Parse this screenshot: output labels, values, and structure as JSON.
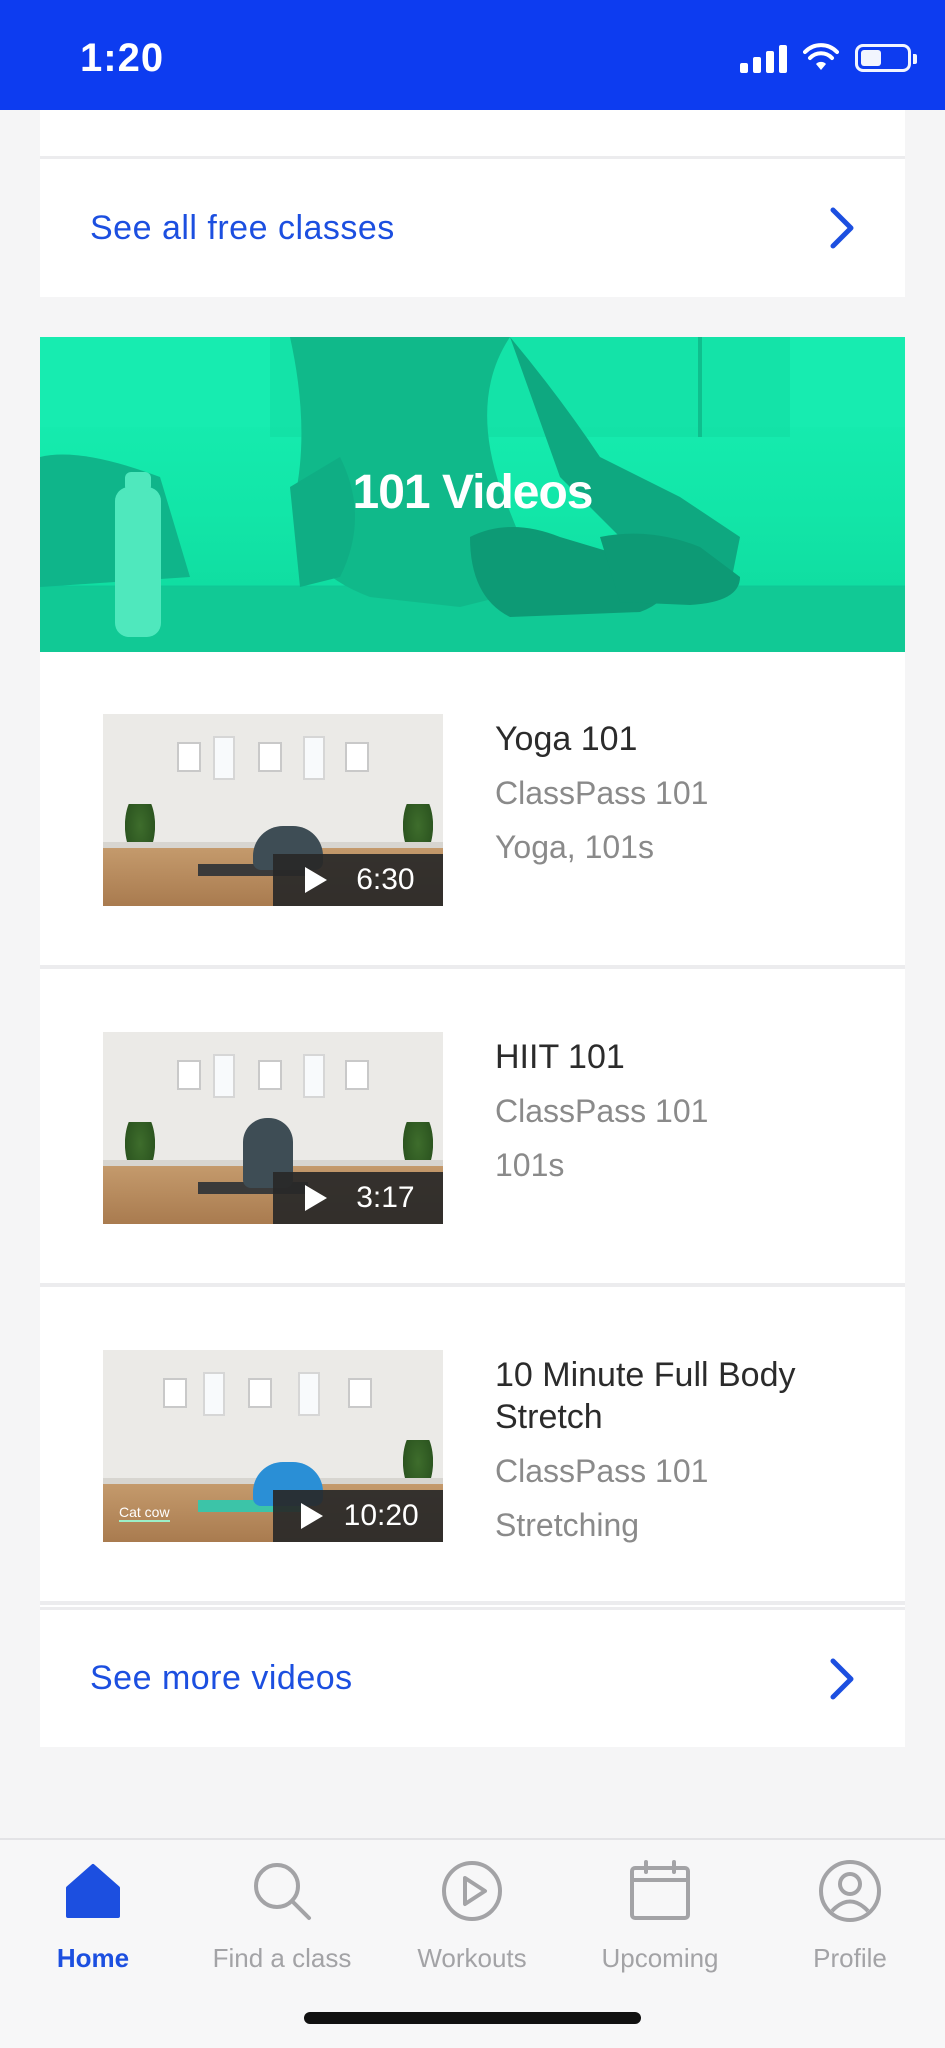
{
  "status_bar": {
    "time": "1:20"
  },
  "free_classes": {
    "link_label": "See all free classes"
  },
  "videos_section": {
    "banner_title": "101 Videos",
    "items": [
      {
        "title": "Yoga 101",
        "provider": "ClassPass 101",
        "category": "Yoga, 101s",
        "duration": "6:30",
        "thumb_caption": ""
      },
      {
        "title": "HIIT 101",
        "provider": "ClassPass 101",
        "category": "101s",
        "duration": "3:17",
        "thumb_caption": ""
      },
      {
        "title": "10 Minute Full Body Stretch",
        "provider": "ClassPass 101",
        "category": "Stretching",
        "duration": "10:20",
        "thumb_caption": "Cat cow"
      }
    ],
    "more_label": "See more videos"
  },
  "tab_bar": {
    "tabs": [
      {
        "label": "Home",
        "icon": "home-icon",
        "active": true
      },
      {
        "label": "Find a class",
        "icon": "search-icon",
        "active": false
      },
      {
        "label": "Workouts",
        "icon": "play-circle-icon",
        "active": false
      },
      {
        "label": "Upcoming",
        "icon": "calendar-icon",
        "active": false
      },
      {
        "label": "Profile",
        "icon": "profile-icon",
        "active": false
      }
    ]
  },
  "colors": {
    "brand_blue": "#0d3cf0",
    "link_blue": "#1c4fe0",
    "banner_green": "#19f0b4",
    "muted_text": "#8a8a8a"
  }
}
